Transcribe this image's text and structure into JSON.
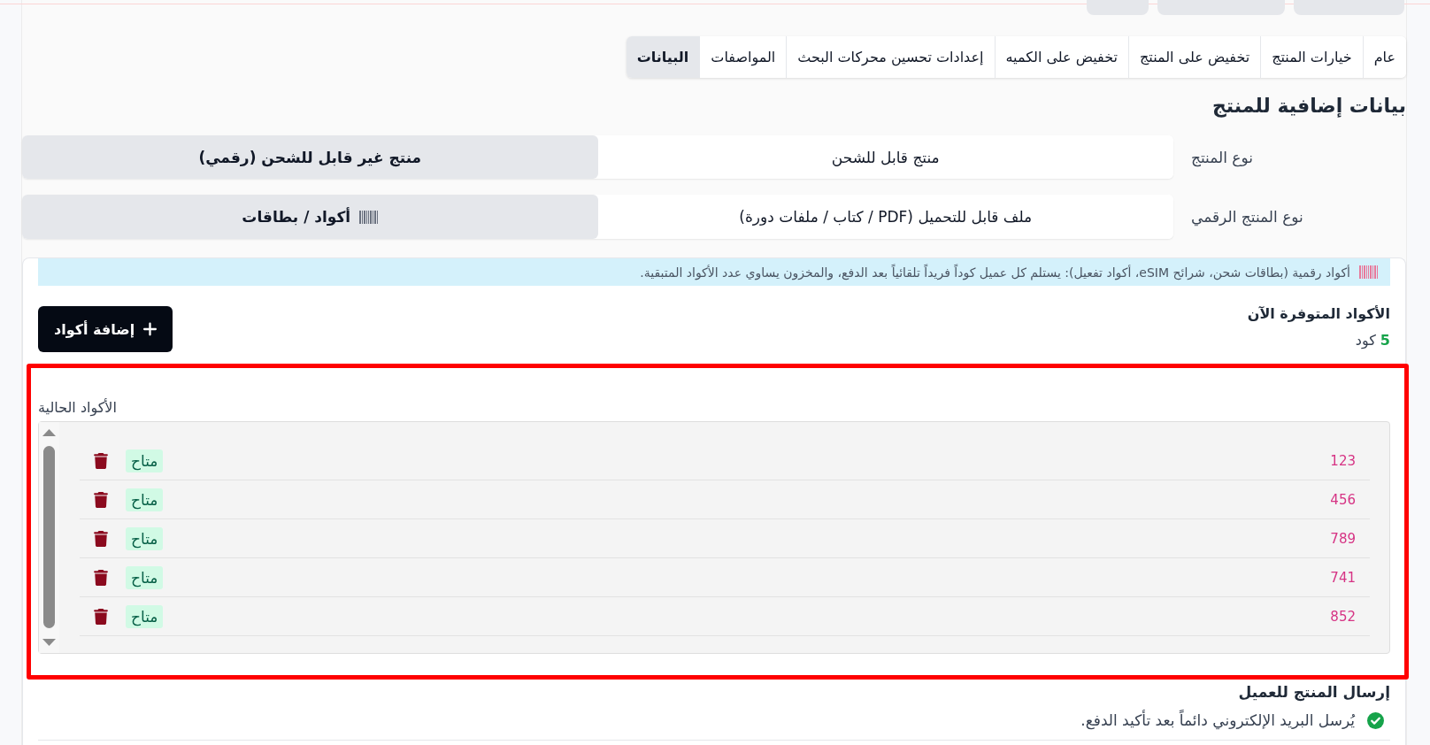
{
  "tabs": [
    {
      "label": "عام",
      "selected": false
    },
    {
      "label": "خيارات المنتج",
      "selected": false
    },
    {
      "label": "تخفيض على المنتج",
      "selected": false
    },
    {
      "label": "تخفيض على الكميه",
      "selected": false
    },
    {
      "label": "إعدادات تحسين محركات البحث",
      "selected": false
    },
    {
      "label": "المواصفات",
      "selected": false
    },
    {
      "label": "البيانات",
      "selected": true
    }
  ],
  "section_title": "بيانات إضافية للمنتج",
  "fields": [
    {
      "label": "نوع المنتج",
      "options": [
        {
          "label": "منتج قابل للشحن",
          "selected": false
        },
        {
          "label": "منتج غير قابل للشحن (رقمي)",
          "selected": true
        }
      ]
    },
    {
      "label": "نوع المنتج الرقمي",
      "options": [
        {
          "label": "ملف قابل للتحميل (PDF / كتاب / ملفات دورة)",
          "selected": false,
          "kind": "file"
        },
        {
          "label": "أكواد / بطاقات",
          "selected": true,
          "kind": "codes"
        }
      ]
    }
  ],
  "codes_panel": {
    "notice": "أكواد رقمية (بطاقات شحن، شرائح eSIM، أكواد تفعيل): يستلم كل عميل كوداً فريداً تلقائياً بعد الدفع، والمخزون يساوي عدد الأكواد المتبقية.",
    "available_title": "الأكواد المتوفرة الآن",
    "available_count": "5",
    "available_unit": "كود",
    "add_button": "إضافة أكواد",
    "list_label": "الأكواد الحالية",
    "codes": [
      {
        "code": "123",
        "status": "متاح"
      },
      {
        "code": "456",
        "status": "متاح"
      },
      {
        "code": "789",
        "status": "متاح"
      },
      {
        "code": "741",
        "status": "متاح"
      },
      {
        "code": "852",
        "status": "متاح"
      }
    ]
  },
  "delivery": {
    "title": "إرسال المنتج للعميل",
    "note": "يُرسل البريد الإلكتروني دائماً بعد تأكيد الدفع."
  }
}
